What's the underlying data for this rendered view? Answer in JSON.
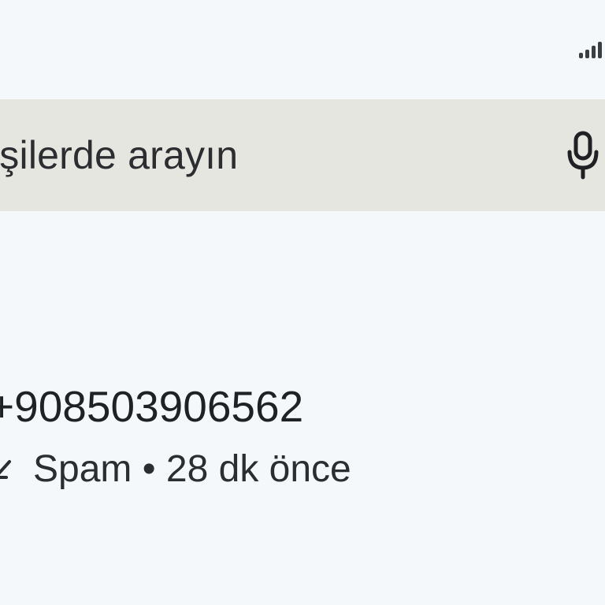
{
  "status_bar": {
    "signal_icon": "signal-strength-icon"
  },
  "search": {
    "placeholder": "işilerde arayın",
    "mic_icon": "microphone-icon"
  },
  "call_log": {
    "entries": [
      {
        "number": "908503906562",
        "number_prefix": "+",
        "call_type_icon": "missed-call-icon",
        "label": "Spam",
        "separator": "•",
        "time": "28 dk önce"
      }
    ]
  },
  "colors": {
    "background": "#f4f8fb",
    "search_background": "#e6e6e1",
    "text": "#1f2124"
  }
}
